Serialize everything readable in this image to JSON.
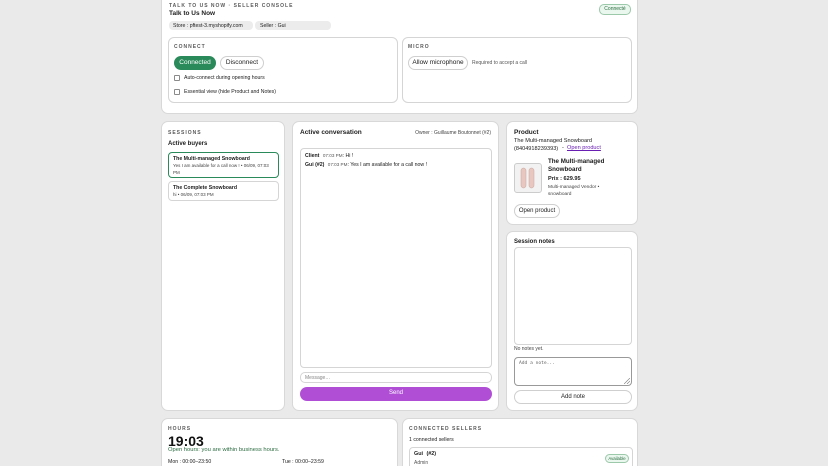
{
  "header": {
    "console_title": "TALK TO US NOW · SELLER CONSOLE",
    "app_name": "Talk to Us Now",
    "connected_badge": "Connecté",
    "store_label": "Store : pftest-3.myshopify.com",
    "seller_label": "Seller : Gui"
  },
  "connect": {
    "section_title": "CONNECT",
    "connected_button": "Connected",
    "disconnect_button": "Disconnect",
    "auto_connect_label": "Auto-connect during opening hours",
    "essential_view_label": "Essential view (hide Product and Notes)"
  },
  "micro": {
    "section_title": "MICRO",
    "allow_button": "Allow microphone",
    "hint": "Required to accept a call"
  },
  "sessions": {
    "section_title": "SESSIONS",
    "active_buyers_title": "Active buyers",
    "buyers": [
      {
        "name": "The Multi-managed Snowboard",
        "preview": "Yes I am available for a call now ! • 06/09, 07:03 PM"
      },
      {
        "name": "The Complete Snowboard",
        "preview": "hi • 06/09, 07:03 PM"
      }
    ]
  },
  "conversation": {
    "title": "Active conversation",
    "owner": "Owner : Guillaume Boutonnet (#2)",
    "messages": [
      {
        "sender": "Client",
        "time": "07:03 PM",
        "text": "Hi !"
      },
      {
        "sender": "Gui (#2)",
        "time": "07:03 PM",
        "text": "Yes I am available for a call now !"
      }
    ],
    "message_placeholder": "Message…",
    "send_button": "Send"
  },
  "product": {
    "title": "Product",
    "full_name": "The Multi-managed Snowboard (8404918239393)",
    "separator": "-",
    "open_link": "Open product",
    "card_name": "The Multi-managed Snowboard",
    "price": "Prix : 629.95",
    "vendor": "Multi-managed Vendor • snowboard",
    "open_button": "Open product"
  },
  "notes": {
    "title": "Session notes",
    "empty_text": "No notes yet.",
    "add_placeholder": "Add a note...",
    "add_button": "Add note"
  },
  "hours": {
    "section_title": "HOURS",
    "clock": "19:03",
    "status": "Open hours: you are within business hours.",
    "mon": "Mon : 00:00–23:50",
    "tue": "Tue : 00:00–23:59"
  },
  "sellers": {
    "section_title": "CONNECTED SELLERS",
    "count_label": "1 connected sellers",
    "list": [
      {
        "name": "Gui",
        "id": "(#2)",
        "role": "Admin",
        "status": "Available"
      }
    ]
  },
  "colors": {
    "accent_purple": "#b04fd6",
    "connected_green": "#2a8a5a",
    "link_purple": "#6a1fb3",
    "available_green": "#eaf7ee"
  }
}
